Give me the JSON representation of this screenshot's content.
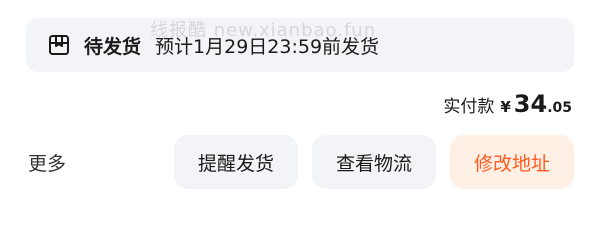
{
  "status": {
    "label": "待发货",
    "description": "预计1月29日23:59前发货",
    "icon": "package-box-icon"
  },
  "watermark": "线报酷 new.xianbao.fun",
  "payment": {
    "label": "实付款",
    "currency": "¥",
    "amount_int": "34",
    "amount_dec": ".05"
  },
  "actions": {
    "more": "更多",
    "remind": "提醒发货",
    "logistics": "查看物流",
    "change_address": "修改地址"
  },
  "colors": {
    "accent": "#ff5a1f",
    "accent_bg": "#fff0e6",
    "neutral_bg": "#f2f4f8"
  }
}
